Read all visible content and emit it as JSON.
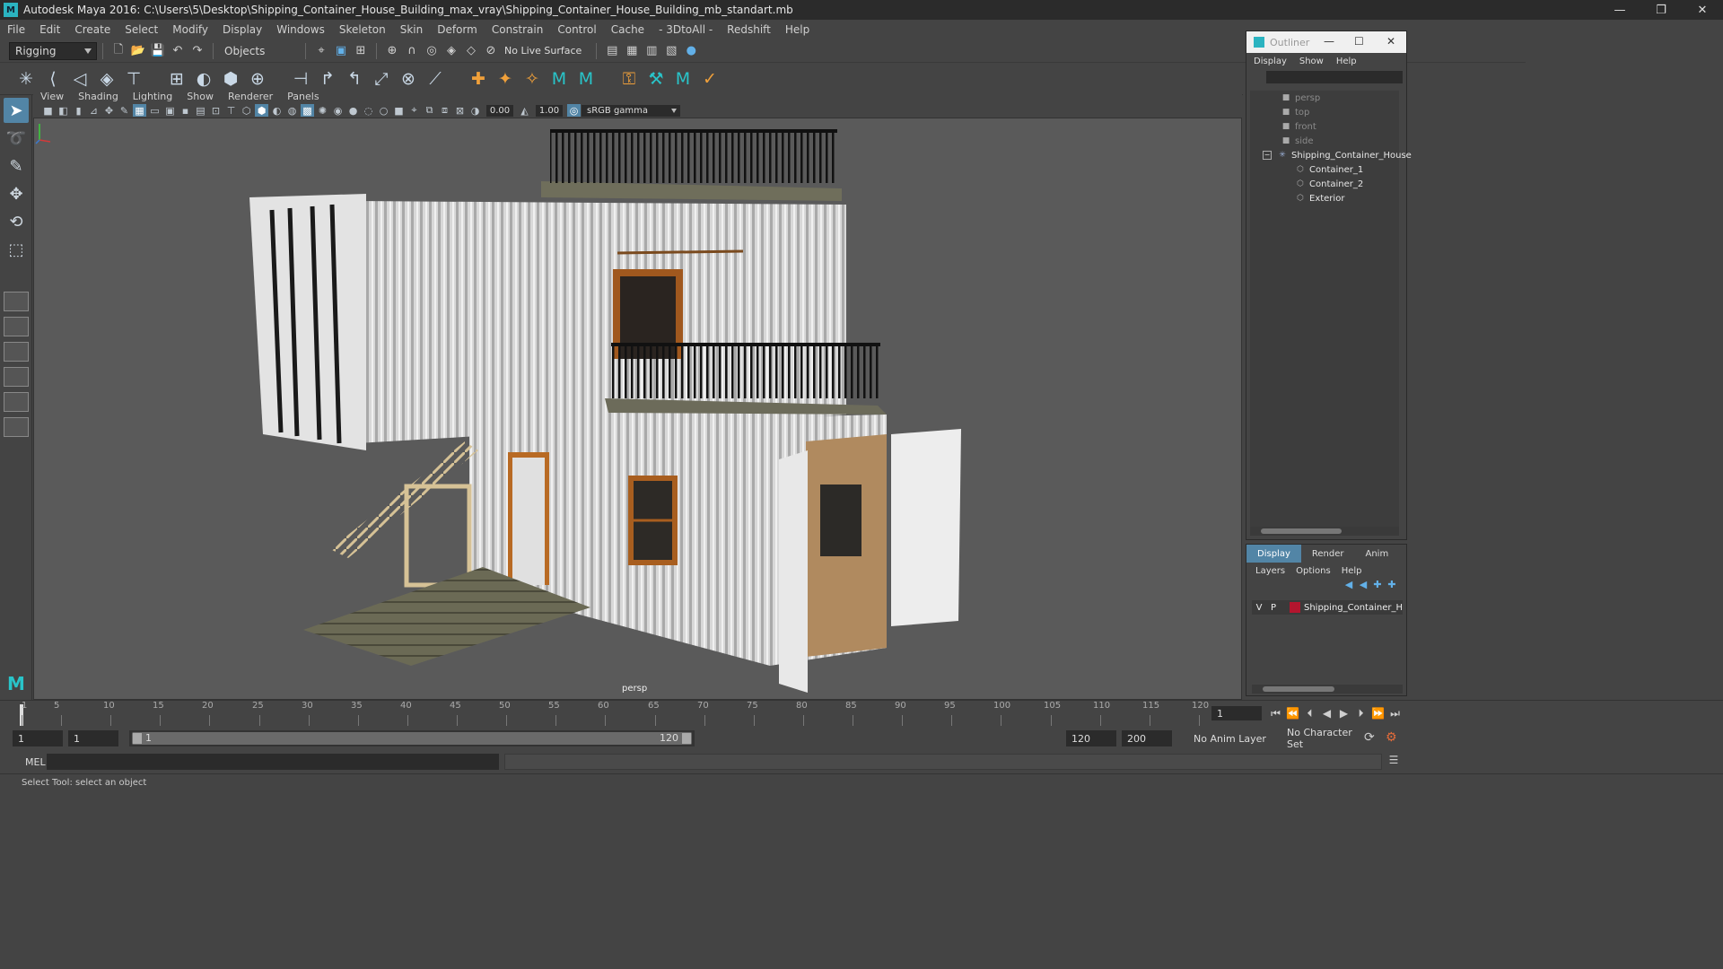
{
  "window": {
    "title": "Autodesk Maya 2016: C:\\Users\\5\\Desktop\\Shipping_Container_House_Building_max_vray\\Shipping_Container_House_Building_mb_standart.mb",
    "minimize": "—",
    "restore": "❐",
    "close": "✕"
  },
  "menubar": [
    "File",
    "Edit",
    "Create",
    "Select",
    "Modify",
    "Display",
    "Windows",
    "Skeleton",
    "Skin",
    "Deform",
    "Constrain",
    "Control",
    "Cache",
    "- 3DtoAll -",
    "Redshift",
    "Help"
  ],
  "statusline": {
    "menuset": "Rigging",
    "selection_mode": "Objects",
    "live_surface": "No Live Surface"
  },
  "viewport": {
    "menu": [
      "View",
      "Shading",
      "Lighting",
      "Show",
      "Renderer",
      "Panels"
    ],
    "exposure": "0.00",
    "gamma": "1.00",
    "color_space": "sRGB gamma",
    "camera_label": "persp"
  },
  "outliner": {
    "title": "Outliner",
    "menu": [
      "Display",
      "Show",
      "Help"
    ],
    "items": [
      {
        "label": "persp",
        "type": "camera"
      },
      {
        "label": "top",
        "type": "camera"
      },
      {
        "label": "front",
        "type": "camera"
      },
      {
        "label": "side",
        "type": "camera"
      },
      {
        "label": "Shipping_Container_House",
        "type": "group"
      },
      {
        "label": "Container_1",
        "type": "mesh"
      },
      {
        "label": "Container_2",
        "type": "mesh"
      },
      {
        "label": "Exterior",
        "type": "mesh"
      }
    ]
  },
  "layers": {
    "tabs": [
      "Display",
      "Render",
      "Anim"
    ],
    "active_tab": "Display",
    "menu": [
      "Layers",
      "Options",
      "Help"
    ],
    "row": {
      "v": "V",
      "p": "P",
      "name": "Shipping_Container_H",
      "color": "#b3152e"
    }
  },
  "timeline": {
    "ticks": [
      "1",
      "5",
      "10",
      "15",
      "20",
      "25",
      "30",
      "35",
      "40",
      "45",
      "50",
      "55",
      "60",
      "65",
      "70",
      "75",
      "80",
      "85",
      "90",
      "95",
      "100",
      "105",
      "110",
      "115",
      "120"
    ],
    "current_frame": "1"
  },
  "range": {
    "start": "1",
    "playback_start": "1",
    "slider_start": "1",
    "slider_end": "120",
    "playback_end": "120",
    "end": "200",
    "anim_layer": "No Anim Layer",
    "character_set": "No Character Set"
  },
  "command": {
    "language": "MEL"
  },
  "help_line": "Select Tool: select an object",
  "colors": {
    "accent": "#5285a6",
    "maya_teal": "#29c4c9",
    "viewport_bg": "#5a5a5a"
  }
}
